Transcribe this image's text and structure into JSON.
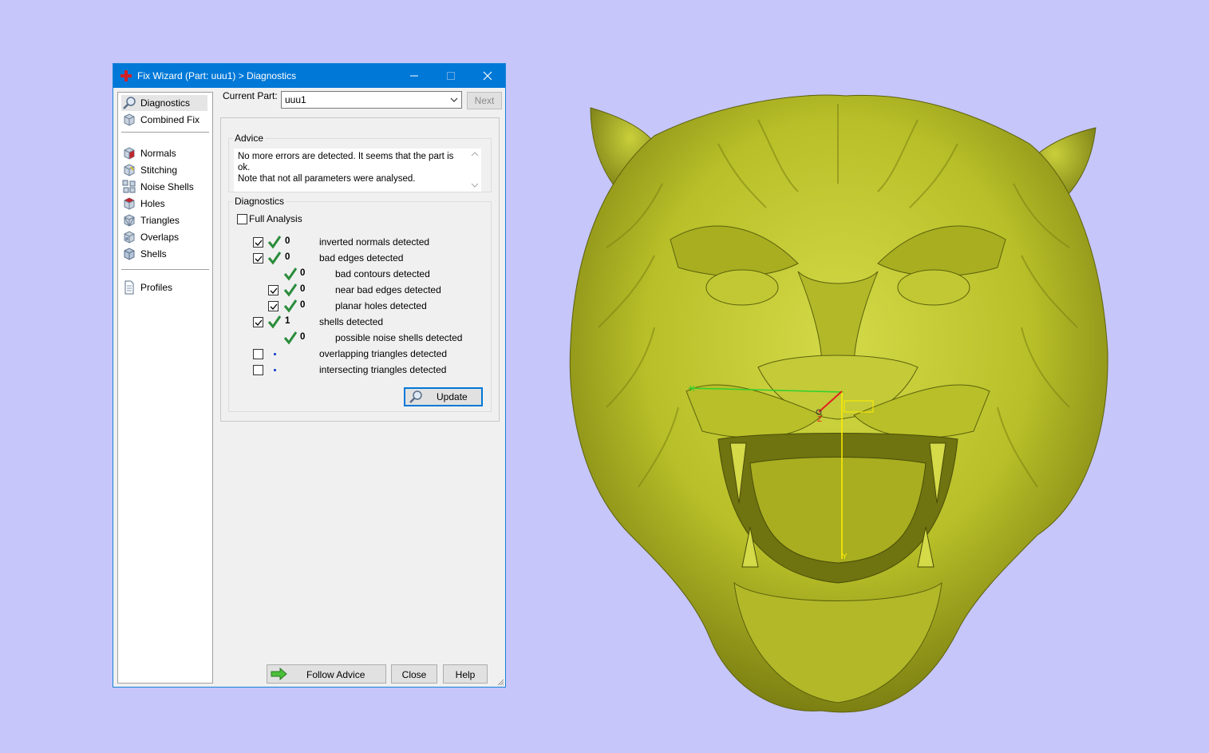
{
  "window": {
    "title": "Fix Wizard (Part: uuu1) > Diagnostics",
    "accent": "#0078d7"
  },
  "sidebar": {
    "items": [
      {
        "label": "Diagnostics",
        "icon": "magnifier-icon",
        "selected": true
      },
      {
        "label": "Combined Fix",
        "icon": "cube-icon"
      },
      {
        "label": "Normals",
        "icon": "normals-cube-icon"
      },
      {
        "label": "Stitching",
        "icon": "stitching-cube-icon"
      },
      {
        "label": "Noise Shells",
        "icon": "noise-shells-icon"
      },
      {
        "label": "Holes",
        "icon": "holes-cube-icon"
      },
      {
        "label": "Triangles",
        "icon": "triangles-cube-icon"
      },
      {
        "label": "Overlaps",
        "icon": "overlaps-cube-icon"
      },
      {
        "label": "Shells",
        "icon": "shells-cube-icon"
      },
      {
        "label": "Profiles",
        "icon": "document-icon"
      }
    ]
  },
  "main": {
    "current_part_label": "Current Part:",
    "current_part_value": "uuu1",
    "next_label": "Next",
    "advice": {
      "title": "Advice",
      "line1": "No more errors are detected. It seems that the part is ok.",
      "line2": "Note that not all parameters were analysed."
    },
    "diagnostics": {
      "title": "Diagnostics",
      "full_analysis_label": "Full Analysis",
      "full_analysis_checked": false,
      "rows": [
        {
          "checkbox": true,
          "checked": true,
          "status": "ok",
          "count": "0",
          "label": "inverted normals detected",
          "indent": 0
        },
        {
          "checkbox": true,
          "checked": true,
          "status": "ok",
          "count": "0",
          "label": "bad edges detected",
          "indent": 0
        },
        {
          "checkbox": false,
          "checked": false,
          "status": "ok",
          "count": "0",
          "label": "bad contours detected",
          "indent": 1
        },
        {
          "checkbox": true,
          "checked": true,
          "status": "ok",
          "count": "0",
          "label": "near bad edges detected",
          "indent": 1
        },
        {
          "checkbox": true,
          "checked": true,
          "status": "ok",
          "count": "0",
          "label": "planar holes detected",
          "indent": 1
        },
        {
          "checkbox": true,
          "checked": true,
          "status": "ok",
          "count": "1",
          "label": "shells detected",
          "indent": 0
        },
        {
          "checkbox": false,
          "checked": false,
          "status": "ok",
          "count": "0",
          "label": "possible noise shells detected",
          "indent": 1
        },
        {
          "checkbox": true,
          "checked": false,
          "status": "none",
          "count": "",
          "label": "overlapping triangles detected",
          "indent": 0
        },
        {
          "checkbox": true,
          "checked": false,
          "status": "none",
          "count": "",
          "label": "intersecting triangles detected",
          "indent": 0
        }
      ],
      "update_label": "Update"
    }
  },
  "footer": {
    "follow_advice_label": "Follow Advice",
    "close_label": "Close",
    "help_label": "Help"
  },
  "viewport": {
    "background": "#c6c6fa",
    "model_color": "#b8bf28",
    "axis_labels": {
      "x": "X",
      "y": "Y",
      "z": "Z"
    }
  }
}
